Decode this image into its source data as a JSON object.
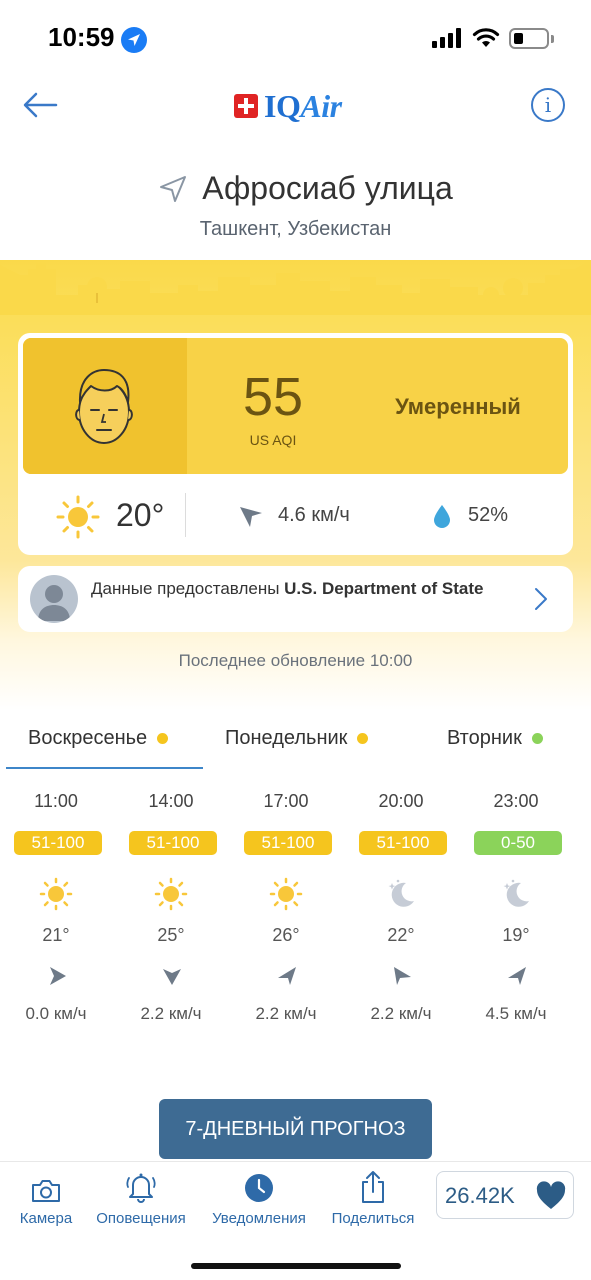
{
  "status_bar": {
    "time": "10:59"
  },
  "header": {
    "logo_text_iq": "IQ",
    "logo_text_air": "Air",
    "info_label": "i"
  },
  "location": {
    "name": "Афросиаб улица",
    "region": "Ташкент, Узбекистан"
  },
  "aqi": {
    "value": "55",
    "unit": "US AQI",
    "level": "Умеренный",
    "colors": {
      "band": "#f8d247",
      "face_box": "#f0c22e",
      "text": "#6b5412"
    }
  },
  "weather": {
    "temp": "20°",
    "wind": "4.6 км/ч",
    "humidity": "52%"
  },
  "source": {
    "prefix": "Данные предоставлены ",
    "org": "U.S. Department of State"
  },
  "last_update": "Последнее обновление 10:00",
  "tabs": [
    {
      "label": "Воскресенье",
      "dot_color": "#f5c51e",
      "active": true
    },
    {
      "label": "Понедельник",
      "dot_color": "#f5c51e",
      "active": false
    },
    {
      "label": "Вторник",
      "dot_color": "#8bd35a",
      "active": false
    }
  ],
  "hourly": [
    {
      "time": "11:00",
      "aqi_range": "51-100",
      "range_color": "#f5c51e",
      "icon": "sun-icon",
      "temp": "21°",
      "wind": "0.0 км/ч"
    },
    {
      "time": "14:00",
      "aqi_range": "51-100",
      "range_color": "#f5c51e",
      "icon": "sun-icon",
      "temp": "25°",
      "wind": "2.2 км/ч"
    },
    {
      "time": "17:00",
      "aqi_range": "51-100",
      "range_color": "#f5c51e",
      "icon": "sun-icon",
      "temp": "26°",
      "wind": "2.2 км/ч"
    },
    {
      "time": "20:00",
      "aqi_range": "51-100",
      "range_color": "#f5c51e",
      "icon": "moon-icon",
      "temp": "22°",
      "wind": "2.2 км/ч"
    },
    {
      "time": "23:00",
      "aqi_range": "0-50",
      "range_color": "#8bd35a",
      "icon": "moon-icon",
      "temp": "19°",
      "wind": "4.5 км/ч"
    }
  ],
  "forecast_button": "7-ДНЕВНЫЙ ПРОГНОЗ",
  "bottom_nav": [
    {
      "label": "Камера",
      "icon": "camera-icon"
    },
    {
      "label": "Оповещения",
      "icon": "bell-icon"
    },
    {
      "label": "Уведомления",
      "icon": "clock-icon"
    },
    {
      "label": "Поделиться",
      "icon": "share-icon"
    }
  ],
  "likes": {
    "count": "26.42K"
  }
}
